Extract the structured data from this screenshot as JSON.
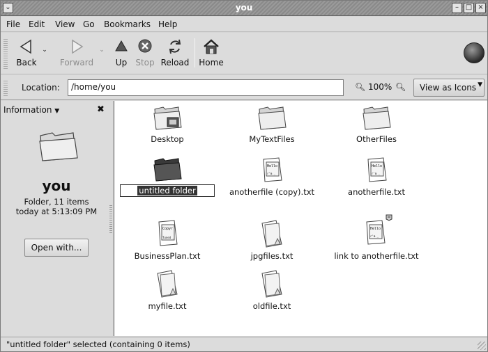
{
  "window": {
    "title": "you"
  },
  "menubar": {
    "items": [
      "File",
      "Edit",
      "View",
      "Go",
      "Bookmarks",
      "Help"
    ]
  },
  "toolbar": {
    "back": "Back",
    "forward": "Forward",
    "up": "Up",
    "stop": "Stop",
    "reload": "Reload",
    "home": "Home"
  },
  "location": {
    "label": "Location:",
    "value": "/home/you",
    "zoom": "100%",
    "view_as": "View as Icons"
  },
  "sidepane": {
    "header": "Information",
    "folder_name": "you",
    "info_line1": "Folder, 11 items",
    "info_line2": "today at 5:13:09 PM",
    "open_with": "Open with..."
  },
  "files": [
    {
      "name": "Desktop",
      "kind": "folder-desktop-icon"
    },
    {
      "name": "MyTextFiles",
      "kind": "folder-icon"
    },
    {
      "name": "OtherFiles",
      "kind": "folder-icon"
    },
    {
      "name": "untitled folder",
      "kind": "folder-selected-icon",
      "selected": true
    },
    {
      "name": "anotherfile (copy).txt",
      "kind": "text-file-hello-icon"
    },
    {
      "name": "anotherfile.txt",
      "kind": "text-file-hello-icon"
    },
    {
      "name": "BusinessPlan.txt",
      "kind": "text-file-copyright-icon"
    },
    {
      "name": "jpgfiles.txt",
      "kind": "text-file-icon"
    },
    {
      "name": "link to anotherfile.txt",
      "kind": "text-file-hello-link-icon"
    },
    {
      "name": "myfile.txt",
      "kind": "text-file-icon"
    },
    {
      "name": "oldfile.txt",
      "kind": "text-file-icon"
    }
  ],
  "statusbar": {
    "text": "\"untitled folder\" selected (containing 0 items)"
  }
}
